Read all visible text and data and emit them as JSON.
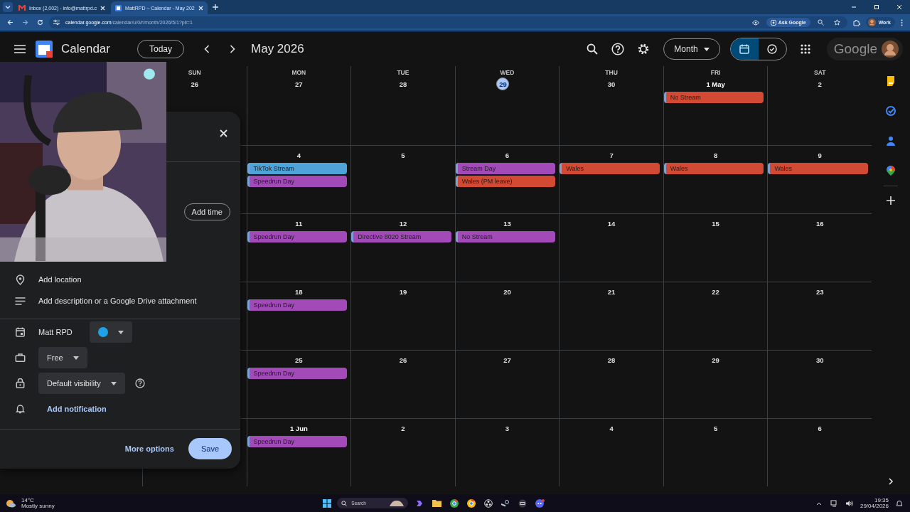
{
  "browser": {
    "tabs": [
      {
        "title": "Inbox (2,002) - info@mattrpd.c",
        "kind": "mail",
        "selected": false
      },
      {
        "title": "MattRPD – Calendar - May 202",
        "kind": "calendar",
        "selected": true
      }
    ],
    "address": {
      "host": "calendar.google.com",
      "path": "/calendar/u/0/r/month/2026/5/1?pli=1"
    },
    "ask_button": "Ask Google",
    "profile": "Work"
  },
  "header": {
    "app_name": "Calendar",
    "today_button": "Today",
    "period": "May 2026",
    "view_selector": "Month",
    "view_toggle": [
      {
        "kind": "calendar",
        "selected": true
      },
      {
        "kind": "tasks",
        "selected": false
      }
    ],
    "brand": "Google"
  },
  "weekdays": [
    "SUN",
    "MON",
    "TUE",
    "WED",
    "THU",
    "FRI",
    "SAT"
  ],
  "weeks": [
    {
      "sunday": "26",
      "days": [
        {
          "date": "27"
        },
        {
          "date": "28"
        },
        {
          "date": "29",
          "today": true
        },
        {
          "date": "30"
        },
        {
          "date": "1 May",
          "month_start": true,
          "events": [
            {
              "title": "No Stream",
              "color": "#d24a34"
            }
          ]
        },
        {
          "date": "2"
        }
      ]
    },
    {
      "days": [
        {
          "date": "4",
          "events": [
            {
              "title": "TikTok Stream",
              "color": "#4ea3d8"
            },
            {
              "title": "Speedrun Day",
              "color": "#a24ab8"
            }
          ]
        },
        {
          "date": "5"
        },
        {
          "date": "6",
          "events": [
            {
              "title": "Stream Day",
              "color": "#a24ab8"
            },
            {
              "title": "Wales (PM leave)",
              "color": "#d24a34"
            }
          ]
        },
        {
          "date": "7",
          "events": [
            {
              "title": "Wales",
              "color": "#d24a34"
            }
          ]
        },
        {
          "date": "8",
          "events": [
            {
              "title": "Wales",
              "color": "#d24a34"
            }
          ]
        },
        {
          "date": "9",
          "events": [
            {
              "title": "Wales",
              "color": "#d24a34"
            }
          ]
        }
      ]
    },
    {
      "days": [
        {
          "date": "11",
          "events": [
            {
              "title": "Speedrun Day",
              "color": "#a24ab8"
            }
          ]
        },
        {
          "date": "12",
          "events": [
            {
              "title": "Directive 8020 Stream",
              "color": "#a24ab8"
            }
          ]
        },
        {
          "date": "13",
          "events": [
            {
              "title": "No Stream",
              "color": "#a24ab8"
            }
          ]
        },
        {
          "date": "14"
        },
        {
          "date": "15"
        },
        {
          "date": "16"
        }
      ]
    },
    {
      "days": [
        {
          "date": "18",
          "events": [
            {
              "title": "Speedrun Day",
              "color": "#a24ab8"
            }
          ]
        },
        {
          "date": "19"
        },
        {
          "date": "20"
        },
        {
          "date": "21"
        },
        {
          "date": "22"
        },
        {
          "date": "23"
        }
      ]
    },
    {
      "days": [
        {
          "date": "25",
          "events": [
            {
              "title": "Speedrun Day",
              "color": "#a24ab8"
            }
          ]
        },
        {
          "date": "26"
        },
        {
          "date": "27"
        },
        {
          "date": "28"
        },
        {
          "date": "29"
        },
        {
          "date": "30"
        }
      ]
    },
    {
      "days": [
        {
          "date": "1 Jun",
          "month_start": true,
          "events": [
            {
              "title": "Speedrun Day",
              "color": "#a24ab8"
            }
          ]
        },
        {
          "date": "2"
        },
        {
          "date": "3"
        },
        {
          "date": "4"
        },
        {
          "date": "5"
        },
        {
          "date": "6"
        }
      ]
    }
  ],
  "event_dialog": {
    "add_time": "Add time",
    "location": "Add location",
    "description": "Add description or a Google Drive attachment",
    "calendar": {
      "name": "Matt RPD",
      "color": "#1ea1e6"
    },
    "availability": "Free",
    "visibility": "Default visibility",
    "notification": "Add notification",
    "more_options": "More options",
    "save": "Save"
  },
  "taskbar": {
    "temperature": "14°C",
    "weather": "Mostly sunny",
    "search": "Search",
    "time": "19:35",
    "date": "29/04/2026"
  }
}
